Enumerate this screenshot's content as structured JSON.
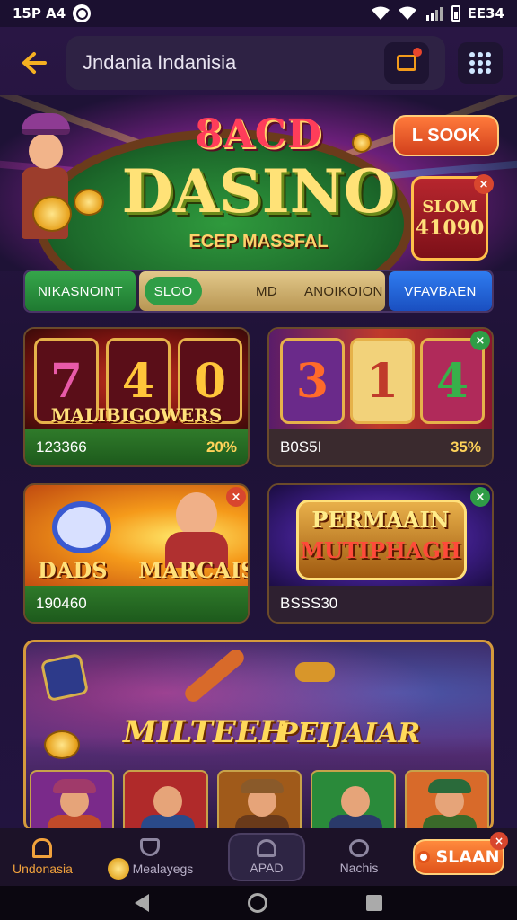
{
  "status": {
    "time": "15P A4",
    "right_time": "EE34"
  },
  "header": {
    "search_text": "Jndania Indanisia"
  },
  "banner": {
    "top_text": "8ACD",
    "main_text": "DASINO",
    "sub_text": "ECEP MASSFAL",
    "book_label": "L SOOK",
    "slot_line1": "SLOM",
    "slot_line2": "41090"
  },
  "tabs": {
    "t1": "NIKASNOINT",
    "t2": "SLOO",
    "t3": "MD",
    "t4": "ANOIKOION",
    "t5": "VFAVBAEN"
  },
  "cards": [
    {
      "title": "MALIBIGOWERS",
      "reels": [
        "7",
        "4",
        "0"
      ],
      "code": "123366",
      "pct": "20%"
    },
    {
      "title": "",
      "reels": [
        "3",
        "1",
        "4"
      ],
      "code": "B0S5I",
      "pct": "35%"
    },
    {
      "title_left": "DADS",
      "title_right": "MARCAIS",
      "code": "190460",
      "pct": ""
    },
    {
      "title1": "PERMAAIN",
      "title2": "MUTIPHAGH",
      "code": "BSSS30",
      "pct": ""
    }
  ],
  "promo": {
    "t1": "MILTEEH",
    "t2": "PEIJAIAR"
  },
  "nav": {
    "home": "Undonasia",
    "item2": "Mealayegs",
    "item3": "APAD",
    "item4": "Nachis",
    "cta": "SLAAN"
  },
  "colors": {
    "accent": "#f0a13c",
    "bg": "#1e1236",
    "green": "#2f9d46",
    "blue": "#2f7cf0"
  }
}
